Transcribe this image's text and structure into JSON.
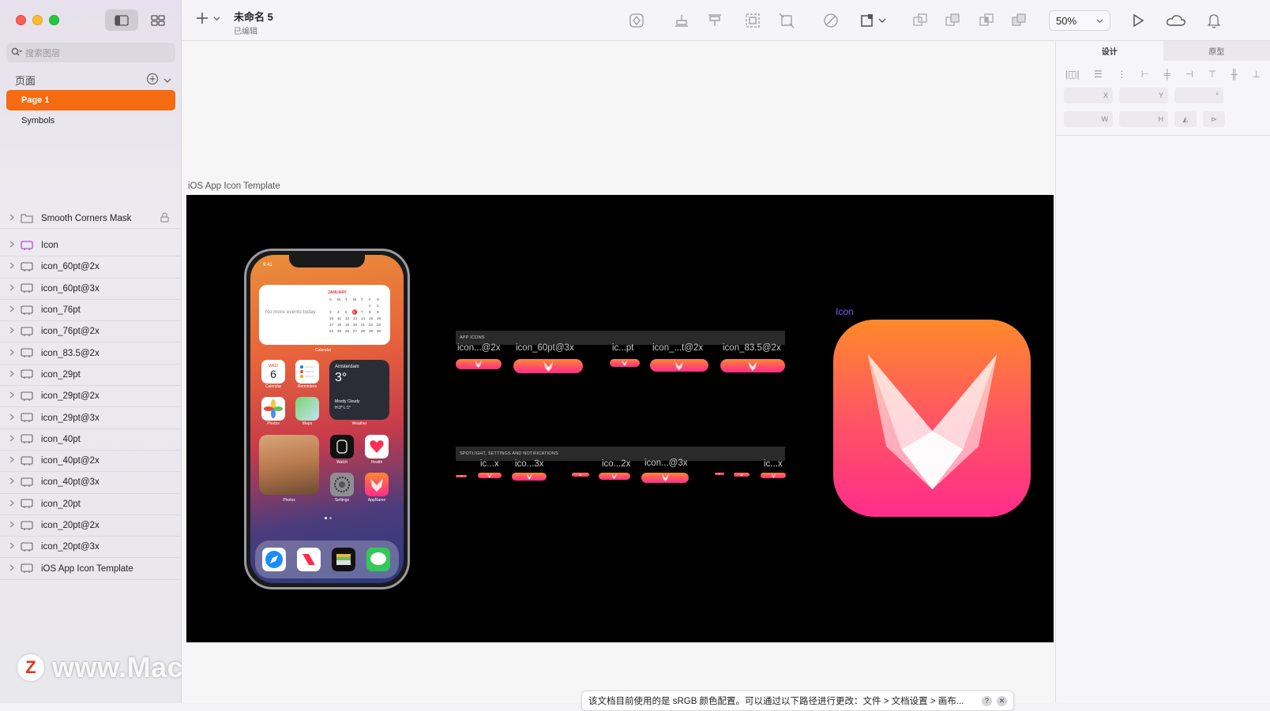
{
  "sidebar": {
    "search_placeholder": "搜索图层",
    "pages_title": "页面",
    "pages": [
      {
        "label": "Page 1",
        "active": true
      },
      {
        "label": "Symbols",
        "active": false
      }
    ],
    "layers": [
      {
        "label": "Smooth Corners Mask",
        "type": "folder",
        "locked": true
      },
      {
        "label": "Icon",
        "type": "symbol-master"
      },
      {
        "label": "icon_60pt@2x",
        "type": "artboard"
      },
      {
        "label": "icon_60pt@3x",
        "type": "artboard"
      },
      {
        "label": "icon_76pt",
        "type": "artboard"
      },
      {
        "label": "icon_76pt@2x",
        "type": "artboard"
      },
      {
        "label": "icon_83.5@2x",
        "type": "artboard"
      },
      {
        "label": "icon_29pt",
        "type": "artboard"
      },
      {
        "label": "icon_29pt@2x",
        "type": "artboard"
      },
      {
        "label": "icon_29pt@3x",
        "type": "artboard"
      },
      {
        "label": "icon_40pt",
        "type": "artboard"
      },
      {
        "label": "icon_40pt@2x",
        "type": "artboard"
      },
      {
        "label": "icon_40pt@3x",
        "type": "artboard"
      },
      {
        "label": "icon_20pt",
        "type": "artboard"
      },
      {
        "label": "icon_20pt@2x",
        "type": "artboard"
      },
      {
        "label": "icon_20pt@3x",
        "type": "artboard"
      },
      {
        "label": "iOS App Icon Template",
        "type": "artboard"
      }
    ]
  },
  "watermark": {
    "logo": "Z",
    "text": "www.MacZ.com"
  },
  "toolbar": {
    "doc_title": "未命名 5",
    "doc_status": "已编辑",
    "zoom": "50%"
  },
  "canvas": {
    "artboard_label": "iOS App Icon Template",
    "big_icon_label": "Icon",
    "section_app": "APP ICONS",
    "section_spotlight": "SPOTLIGHT, SETTINGS AND NOTIFICATIONS",
    "app_icon_labels": [
      "icon...@2x",
      "icon_60pt@3x",
      "ic...pt",
      "icon_...t@2x",
      "icon_83.5@2x"
    ],
    "spot_icon_labels": [
      "ic...x",
      "ico...3x",
      "ico...2x",
      "icon...@3x",
      "ic...x"
    ],
    "phone": {
      "time": "9:41",
      "no_events": "No more events today",
      "cal_month": "JANUARY",
      "cal_widget": "Calendar",
      "day_name": "WED",
      "day_num": "6",
      "weather_city": "Amsterdam",
      "weather_temp": "3°",
      "weather_desc": "Mostly Cloudy",
      "weather_hl": "H:3° L:1°",
      "weather_lbl": "Weather",
      "apps": [
        "Calendar",
        "Reminders",
        "Photos",
        "Maps",
        "Watch",
        "Health",
        "Photos",
        "Settings",
        "AppName"
      ]
    }
  },
  "inspector": {
    "tab_design": "设计",
    "tab_prototype": "原型",
    "fields": [
      "X",
      "Y",
      "°",
      "W",
      "H"
    ]
  },
  "notice": {
    "text": "该文档目前使用的是 sRGB 颜色配置。可以通过以下路径进行更改：文件 > 文档设置 > 画布...",
    "help": "?",
    "close": "✕"
  },
  "colors": {
    "accent": "#f46b12",
    "icon_top": "#ff8a2a",
    "icon_bottom": "#ff2c8a"
  }
}
